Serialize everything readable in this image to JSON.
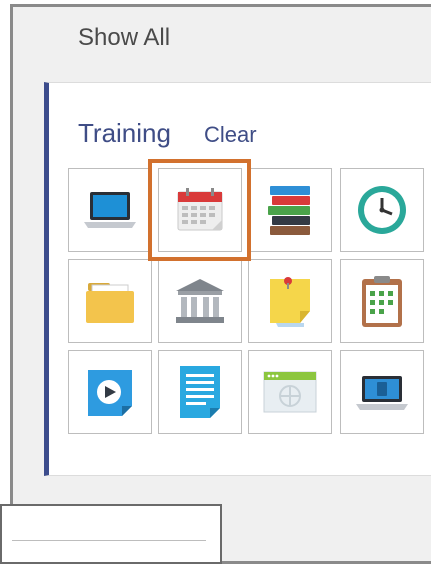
{
  "header": {
    "show_all_label": "Show All"
  },
  "training": {
    "title": "Training",
    "clear_label": "Clear"
  },
  "icons": [
    "laptop-icon",
    "calendar-icon",
    "books-icon",
    "clock-icon",
    "photo-folder-icon",
    "museum-icon",
    "sticky-note-icon",
    "clipboard-icon",
    "video-play-icon",
    "document-icon",
    "web-page-icon",
    "laptop-app-icon"
  ],
  "selected_icon": "calendar-icon",
  "colors": {
    "accent": "#3f4d86",
    "panel_border": "#3c4c8c",
    "highlight": "#d2712e"
  }
}
